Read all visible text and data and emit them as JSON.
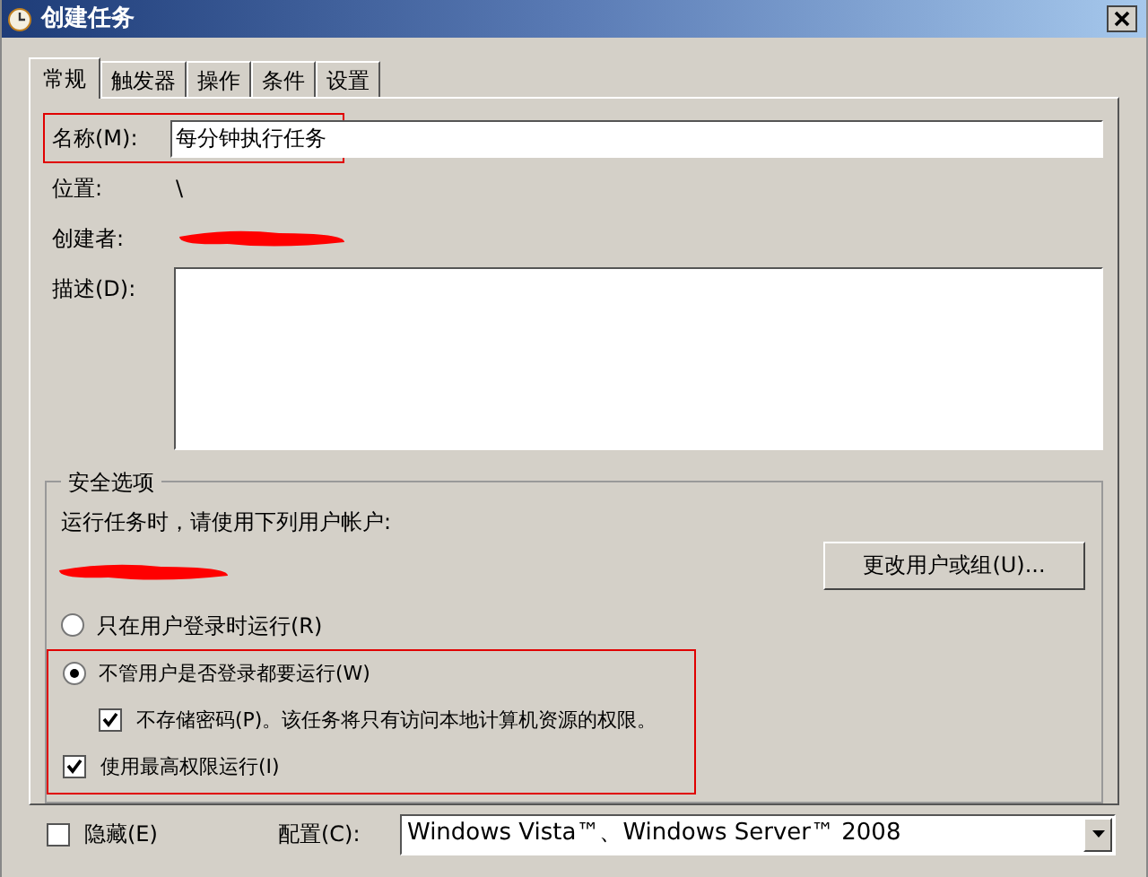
{
  "window": {
    "title": "创建任务"
  },
  "tabs": [
    {
      "label": "常规",
      "selected": true
    },
    {
      "label": "触发器",
      "selected": false
    },
    {
      "label": "操作",
      "selected": false
    },
    {
      "label": "条件",
      "selected": false
    },
    {
      "label": "设置",
      "selected": false
    }
  ],
  "name_field": {
    "label": "名称(M):",
    "value": "每分钟执行任务"
  },
  "location": {
    "label": "位置:",
    "value": "\\"
  },
  "creator": {
    "label": "创建者:"
  },
  "description": {
    "label": "描述(D):"
  },
  "security": {
    "title": "安全选项",
    "account_label": "运行任务时，请使用下列用户帐户:",
    "change_button": "更改用户或组(U)...",
    "options": [
      {
        "kind": "radio",
        "label": "只在用户登录时运行(R)",
        "selected": false
      },
      {
        "kind": "radio",
        "label": "不管用户是否登录都要运行(W)",
        "selected": true,
        "children": [
          {
            "kind": "checkbox",
            "label": "不存储密码(P)。该任务将只有访问本地计算机资源的权限。",
            "checked": true
          }
        ]
      },
      {
        "kind": "checkbox",
        "label": "使用最高权限运行(I)",
        "checked": true
      }
    ]
  },
  "hidden": {
    "label": "隐藏(E)",
    "checked": false
  },
  "config": {
    "label": "配置(C):",
    "value": "Windows Vista™、Windows Server™ 2008"
  }
}
